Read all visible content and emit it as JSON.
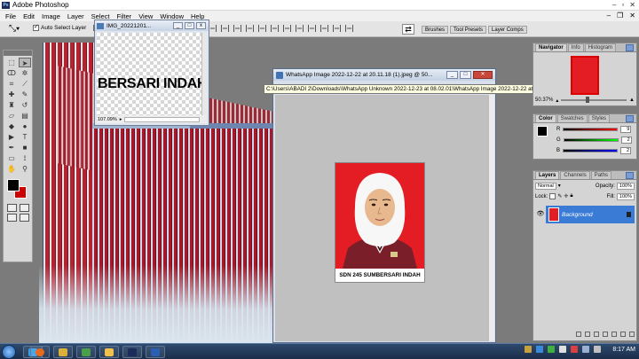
{
  "app": {
    "title": "Adobe Photoshop"
  },
  "menu": [
    "File",
    "Edit",
    "Image",
    "Layer",
    "Select",
    "Filter",
    "View",
    "Window",
    "Help"
  ],
  "options": {
    "auto_select_label": "Auto Select Layer",
    "palette_tabs": [
      "Brushes",
      "Tool Presets",
      "Layer Comps"
    ]
  },
  "small_window": {
    "title": "IMG_20221201...",
    "text": "BERSARI INDAH",
    "zoom": "107.09%"
  },
  "main_window": {
    "title": "WhatsApp Image 2022-12-22 at 20.11.18 (1).jpeg @ 50...",
    "tooltip": "C:\\Users\\ABADI 2\\Downloads\\WhatsApp Unknown 2022-12-23 at 08.02.01\\WhatsApp Image 2022-12-22 at 20.11.18 (1).jpeg @ 50.4% (RGB/8)"
  },
  "photo": {
    "caption": "SDN 245 SUMBERSARI INDAH"
  },
  "navigator": {
    "tabs": [
      "Navigator",
      "Info",
      "Histogram"
    ],
    "zoom": "50.37%"
  },
  "color_panel": {
    "tabs": [
      "Color",
      "Swatches",
      "Styles"
    ],
    "channels": [
      {
        "label": "R",
        "value": "9"
      },
      {
        "label": "G",
        "value": "2"
      },
      {
        "label": "B",
        "value": "2"
      }
    ]
  },
  "layers_panel": {
    "tabs": [
      "Layers",
      "Channels",
      "Paths"
    ],
    "blend_mode": "Normal",
    "opacity_label": "Opacity:",
    "opacity_value": "100%",
    "lock_label": "Lock:",
    "fill_label": "Fill:",
    "fill_value": "100%",
    "layer_name": "Background"
  },
  "taskbar": {
    "time": "8:17 AM"
  },
  "colors": {
    "photo_bg": "#e41c24",
    "layer_selected": "#3a7bd5",
    "taskbar": "#1b2e4a"
  }
}
